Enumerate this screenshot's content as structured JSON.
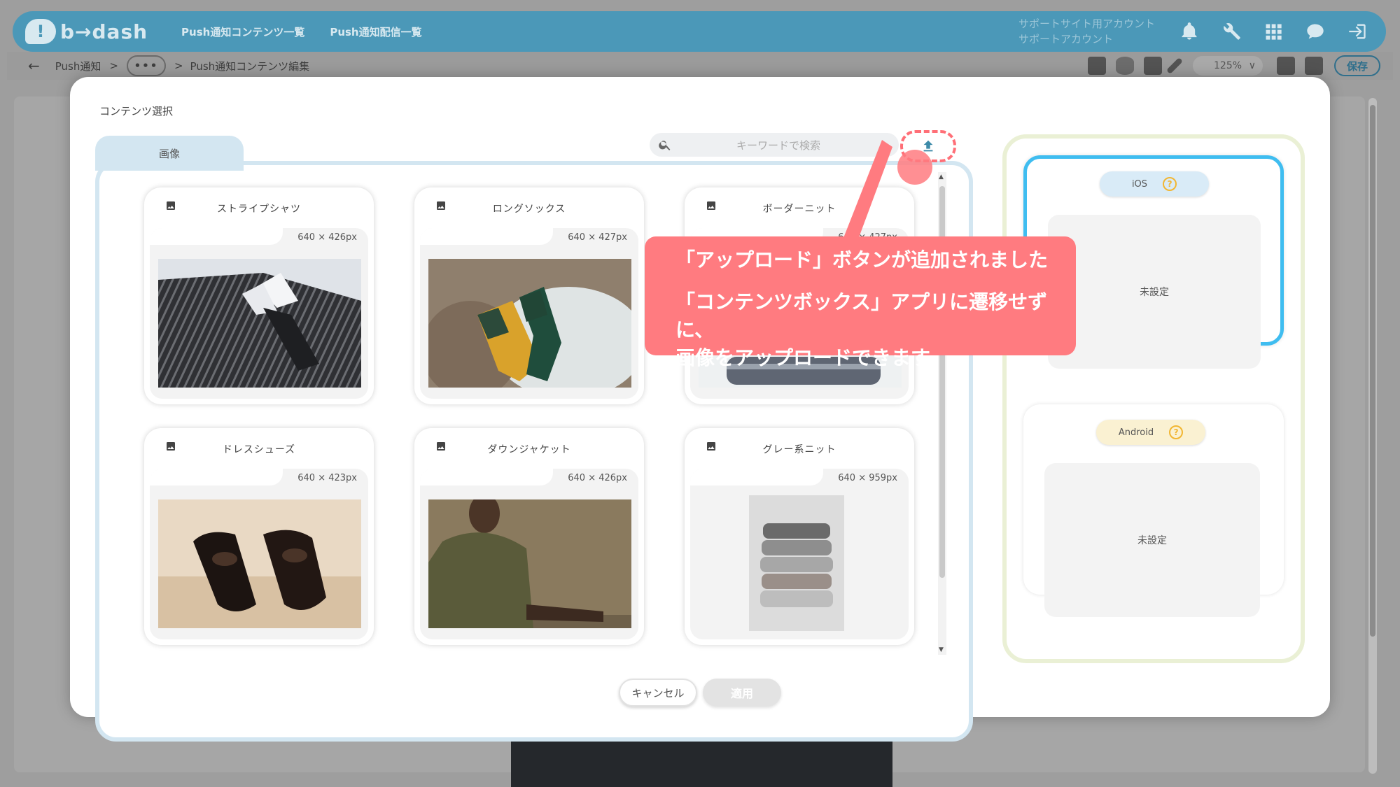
{
  "header": {
    "logo_mark": "!",
    "logo_text": "b→dash",
    "nav": [
      "Push通知コンテンツ一覧",
      "Push通知配信一覧"
    ],
    "account_line1": "サポートサイト用アカウント",
    "account_line2": "サポートアカウント"
  },
  "subbar": {
    "back": "←",
    "crumb1": "Push通知",
    "sep1": ">",
    "dots": "•••",
    "sep2": ">",
    "crumb2": "Push通知コンテンツ編集",
    "zoom": "125%",
    "zoom_caret": "∨",
    "save_label": "保存"
  },
  "modal": {
    "title": "コンテンツ選択",
    "tab_label": "画像",
    "search_placeholder": "キーワードで検索",
    "cards": [
      {
        "name": "ストライプシャツ",
        "size": "640 × 426px"
      },
      {
        "name": "ロングソックス",
        "size": "640 × 427px"
      },
      {
        "name": "ボーダーニット",
        "size": "640 × 427px"
      },
      {
        "name": "ドレスシューズ",
        "size": "640 × 423px"
      },
      {
        "name": "ダウンジャケット",
        "size": "640 × 426px"
      },
      {
        "name": "グレー系ニット",
        "size": "640 × 959px"
      }
    ],
    "ios": {
      "label": "iOS",
      "help": "?",
      "status": "未設定"
    },
    "android": {
      "label": "Android",
      "help": "?",
      "status": "未設定"
    },
    "cancel_label": "キャンセル",
    "apply_label": "適用"
  },
  "callout": {
    "line1": "「アップロード」ボタンが追加されました",
    "line2a": "「コンテンツボックス」アプリに遷移せずに、",
    "line2b": "画像をアップロードできます",
    "color": "#ff7b80"
  },
  "colors": {
    "header": "#4b98b8",
    "ios_border": "#3fbdf0",
    "tab": "#d3e6f1",
    "platform_panel": "#eaf0d5"
  }
}
